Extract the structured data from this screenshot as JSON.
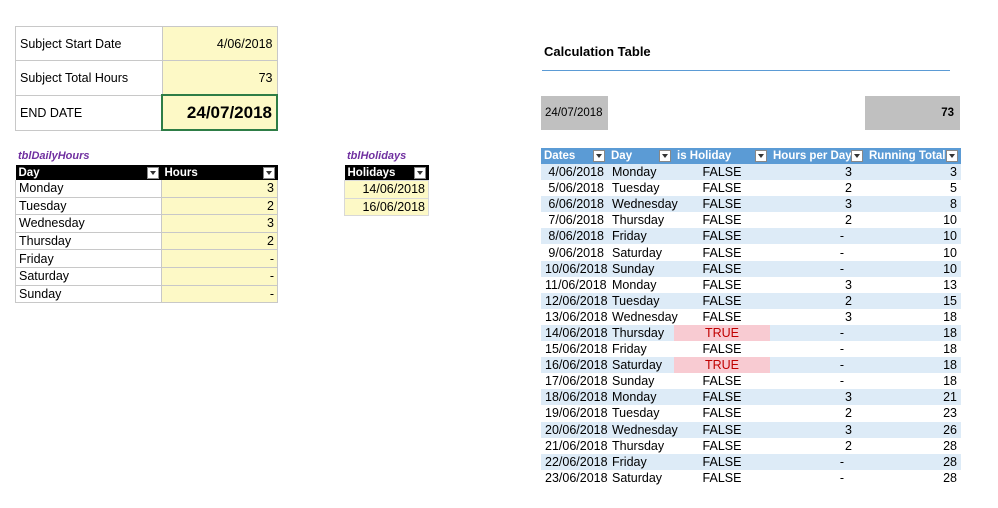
{
  "inputs": {
    "start_label": "Subject Start Date",
    "start_value": "4/06/2018",
    "hours_label": "Subject Total Hours",
    "hours_value": "73",
    "end_label": "END DATE",
    "end_value": "24/07/2018"
  },
  "daily_hours": {
    "table_name": "tblDailyHours",
    "headers": [
      "Day",
      "Hours"
    ],
    "rows": [
      [
        "Monday",
        "3"
      ],
      [
        "Tuesday",
        "2"
      ],
      [
        "Wednesday",
        "3"
      ],
      [
        "Thursday",
        "2"
      ],
      [
        "Friday",
        "-"
      ],
      [
        "Saturday",
        "-"
      ],
      [
        "Sunday",
        "-"
      ]
    ]
  },
  "holidays": {
    "table_name": "tblHolidays",
    "header": "Holidays",
    "rows": [
      "14/06/2018",
      "16/06/2018"
    ]
  },
  "calc": {
    "title": "Calculation Table",
    "summary_date": "24/07/2018",
    "summary_total": "73",
    "headers": [
      "Dates",
      "Day",
      "is Holiday",
      "Hours per Day",
      "Running Total"
    ],
    "rows": [
      [
        "4/06/2018",
        "Monday",
        "FALSE",
        "3",
        "3"
      ],
      [
        "5/06/2018",
        "Tuesday",
        "FALSE",
        "2",
        "5"
      ],
      [
        "6/06/2018",
        "Wednesday",
        "FALSE",
        "3",
        "8"
      ],
      [
        "7/06/2018",
        "Thursday",
        "FALSE",
        "2",
        "10"
      ],
      [
        "8/06/2018",
        "Friday",
        "FALSE",
        "-",
        "10"
      ],
      [
        "9/06/2018",
        "Saturday",
        "FALSE",
        "-",
        "10"
      ],
      [
        "10/06/2018",
        "Sunday",
        "FALSE",
        "-",
        "10"
      ],
      [
        "11/06/2018",
        "Monday",
        "FALSE",
        "3",
        "13"
      ],
      [
        "12/06/2018",
        "Tuesday",
        "FALSE",
        "2",
        "15"
      ],
      [
        "13/06/2018",
        "Wednesday",
        "FALSE",
        "3",
        "18"
      ],
      [
        "14/06/2018",
        "Thursday",
        "TRUE",
        "-",
        "18"
      ],
      [
        "15/06/2018",
        "Friday",
        "FALSE",
        "-",
        "18"
      ],
      [
        "16/06/2018",
        "Saturday",
        "TRUE",
        "-",
        "18"
      ],
      [
        "17/06/2018",
        "Sunday",
        "FALSE",
        "-",
        "18"
      ],
      [
        "18/06/2018",
        "Monday",
        "FALSE",
        "3",
        "21"
      ],
      [
        "19/06/2018",
        "Tuesday",
        "FALSE",
        "2",
        "23"
      ],
      [
        "20/06/2018",
        "Wednesday",
        "FALSE",
        "3",
        "26"
      ],
      [
        "21/06/2018",
        "Thursday",
        "FALSE",
        "2",
        "28"
      ],
      [
        "22/06/2018",
        "Friday",
        "FALSE",
        "-",
        "28"
      ],
      [
        "23/06/2018",
        "Saturday",
        "FALSE",
        "-",
        "28"
      ]
    ]
  },
  "colors": {
    "header_blue": "#5b9bd5",
    "band_blue": "#ddebf7",
    "input_yellow": "#fdf9c6",
    "holiday_pink": "#f8cbd2",
    "table_name_purple": "#7030a0"
  }
}
